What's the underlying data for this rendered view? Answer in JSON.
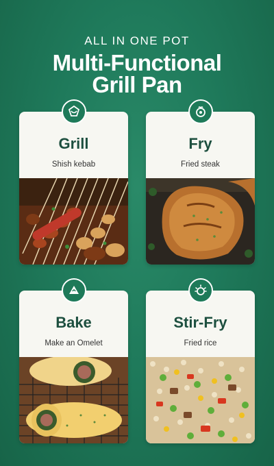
{
  "header": {
    "eyebrow": "ALL IN ONE POT",
    "title_line1": "Multi-Functional",
    "title_line2": "Grill Pan"
  },
  "cards": [
    {
      "name": "Grill",
      "subtitle": "Shish kebab",
      "icon": "grill-icon"
    },
    {
      "name": "Fry",
      "subtitle": "Fried steak",
      "icon": "fry-icon"
    },
    {
      "name": "Bake",
      "subtitle": "Make an Omelet",
      "icon": "bake-icon"
    },
    {
      "name": "Stir-Fry",
      "subtitle": "Fried rice",
      "icon": "stir-fry-icon"
    }
  ],
  "colors": {
    "background": "#1f7a5b",
    "card": "#f7f7f2",
    "title_text": "#1d4f3f",
    "badge": "#1e7a59"
  }
}
